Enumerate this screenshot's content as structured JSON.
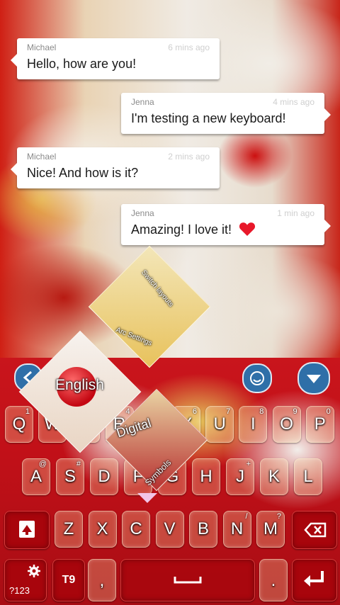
{
  "messages": [
    {
      "sender": "Michael",
      "time": "6 mins ago",
      "text": "Hello, how are you!"
    },
    {
      "sender": "Jenna",
      "time": "4 mins ago",
      "text": "I'm testing a new keyboard!"
    },
    {
      "sender": "Michael",
      "time": "2 mins ago",
      "text": "Nice! And how is it?"
    },
    {
      "sender": "Jenna",
      "time": "1 min ago",
      "text": "Amazing! I love it!"
    }
  ],
  "floating_menu": {
    "switch_layouts": "Switch layouts",
    "arc_settings": "Arc Settings",
    "english": "English",
    "digital": "Digital",
    "symbols": "Symbols"
  },
  "keyboard": {
    "row1": [
      {
        "label": "Q",
        "sub": "1"
      },
      {
        "label": "W",
        "sub": "2"
      },
      {
        "label": "E",
        "sub": "3"
      },
      {
        "label": "R",
        "sub": "4"
      },
      {
        "label": "T",
        "sub": "5"
      },
      {
        "label": "Y",
        "sub": "6"
      },
      {
        "label": "U",
        "sub": "7"
      },
      {
        "label": "I",
        "sub": "8"
      },
      {
        "label": "O",
        "sub": "9"
      },
      {
        "label": "P",
        "sub": "0"
      }
    ],
    "row2": [
      {
        "label": "A",
        "sub": "@"
      },
      {
        "label": "S",
        "sub": "#"
      },
      {
        "label": "D",
        "sub": ""
      },
      {
        "label": "F",
        "sub": ""
      },
      {
        "label": "G",
        "sub": ""
      },
      {
        "label": "H",
        "sub": ""
      },
      {
        "label": "J",
        "sub": "+"
      },
      {
        "label": "K",
        "sub": ""
      },
      {
        "label": "L",
        "sub": ""
      }
    ],
    "row3": [
      {
        "label": "Z",
        "sub": ""
      },
      {
        "label": "X",
        "sub": ""
      },
      {
        "label": "C",
        "sub": ""
      },
      {
        "label": "V",
        "sub": ""
      },
      {
        "label": "B",
        "sub": ""
      },
      {
        "label": "N",
        "sub": "/"
      },
      {
        "label": "M",
        "sub": "?"
      }
    ],
    "symbols_key": "?123",
    "t9_key": "T9",
    "comma_key": ",",
    "period_key": "."
  },
  "colors": {
    "heart": "#e8182a",
    "key_function": "#a8050c",
    "top_button": "#2f6fa8"
  }
}
